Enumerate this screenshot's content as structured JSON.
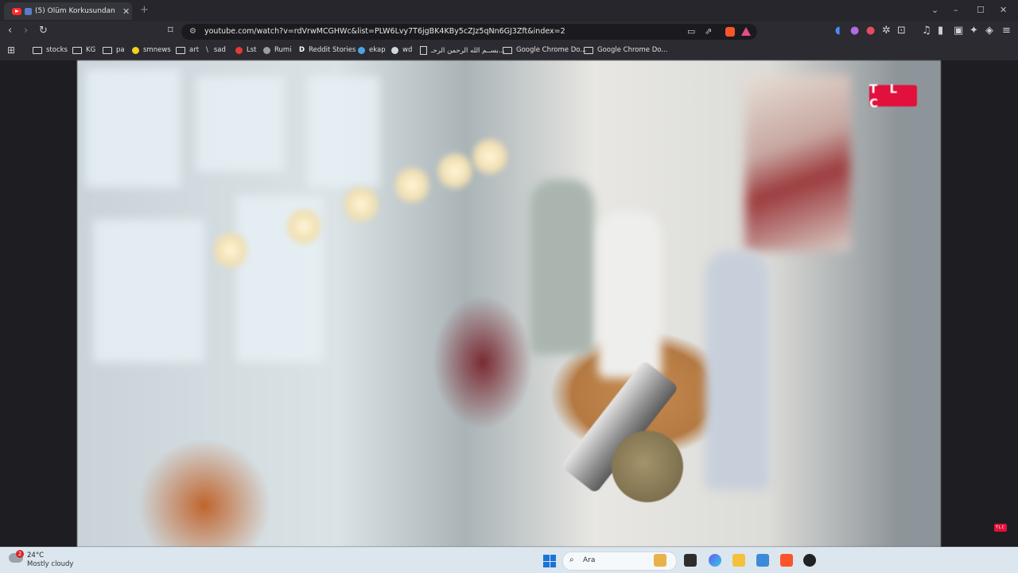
{
  "browser": {
    "tab": {
      "title": "(5) Ölüm Korkusundan Hiçbir",
      "close": "✕",
      "favicon": "youtube-icon"
    },
    "new_tab": "+",
    "window_controls": {
      "dropdown": "⌄",
      "minimize": "–",
      "maximize": "☐",
      "close": "✕"
    },
    "url": "youtube.com/watch?v=rdVrwMCGHWc&list=PLW6Lvy7T6jgBK4KBy5cZJz5qNn6GJ3Zft&index=2"
  },
  "bookmarks": [
    {
      "label": "stocks",
      "icon": "folder-icon"
    },
    {
      "label": "KG",
      "icon": "folder-icon"
    },
    {
      "label": "pa",
      "icon": "folder-icon"
    },
    {
      "label": "smnews",
      "icon": "smiley-icon"
    },
    {
      "label": "art",
      "icon": "folder-icon"
    },
    {
      "label": "sad",
      "icon": "slash-icon"
    },
    {
      "label": "Lst",
      "icon": "s-icon"
    },
    {
      "label": "Rumi",
      "icon": "globe-icon"
    },
    {
      "label": "Reddit Stories",
      "icon": "d-icon"
    },
    {
      "label": "ekap",
      "icon": "bird-icon"
    },
    {
      "label": "wd",
      "icon": "globe-icon"
    },
    {
      "label": "بســم الله الرحمن الرحـ...",
      "icon": "page-icon"
    },
    {
      "label": "Google Chrome Do...",
      "icon": "folder-icon"
    },
    {
      "label": "Google Chrome Do...",
      "icon": "folder-icon"
    }
  ],
  "video": {
    "channel_logo": "T L C",
    "channel_logo_small": "TLC"
  },
  "taskbar": {
    "weather": {
      "temp": "24°C",
      "condition": "Mostly cloudy",
      "badge": "2"
    },
    "search_placeholder": "Ara"
  }
}
